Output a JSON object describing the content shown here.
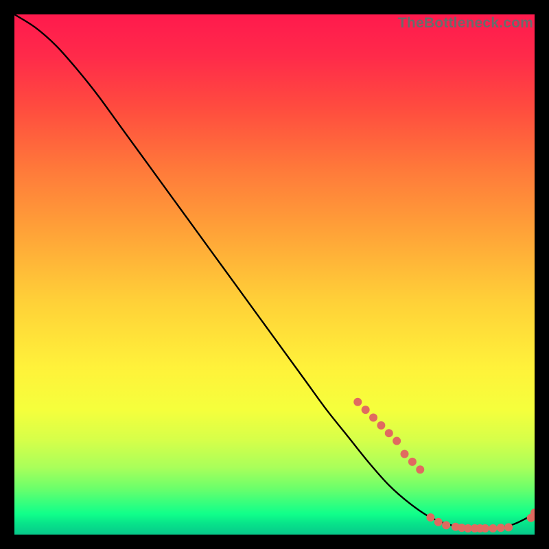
{
  "watermark": "TheBottleneck.com",
  "chart_data": {
    "type": "line",
    "title": "",
    "xlabel": "",
    "ylabel": "",
    "xlim": [
      0,
      100
    ],
    "ylim": [
      0,
      100
    ],
    "grid": false,
    "legend": false,
    "series": [
      {
        "name": "curve",
        "style": "line",
        "color": "#000000",
        "x": [
          0,
          4,
          8,
          12,
          16,
          20,
          24,
          28,
          32,
          36,
          40,
          44,
          48,
          52,
          56,
          60,
          64,
          68,
          72,
          76,
          80,
          84,
          88,
          92,
          96,
          100
        ],
        "y": [
          100,
          97.5,
          94,
          89.5,
          84.5,
          79,
          73.5,
          68,
          62.5,
          57,
          51.5,
          46,
          40.5,
          35,
          29.5,
          24,
          19,
          14,
          9.5,
          6,
          3.3,
          1.8,
          1.2,
          1.2,
          2,
          4
        ]
      },
      {
        "name": "markers",
        "style": "dots",
        "color": "#e06a60",
        "radius": 6,
        "x": [
          66,
          67.5,
          69,
          70.5,
          72,
          73.5,
          75,
          76.5,
          78,
          80,
          81.5,
          83,
          84.8,
          86,
          87.2,
          88.5,
          89.5,
          90.5,
          92,
          93.5,
          95,
          99.3,
          100
        ],
        "y": [
          25.5,
          24,
          22.5,
          21,
          19.5,
          18,
          15.5,
          14,
          12.5,
          3.3,
          2.4,
          1.8,
          1.5,
          1.3,
          1.2,
          1.2,
          1.2,
          1.2,
          1.2,
          1.3,
          1.4,
          3.2,
          4.2
        ]
      }
    ]
  }
}
